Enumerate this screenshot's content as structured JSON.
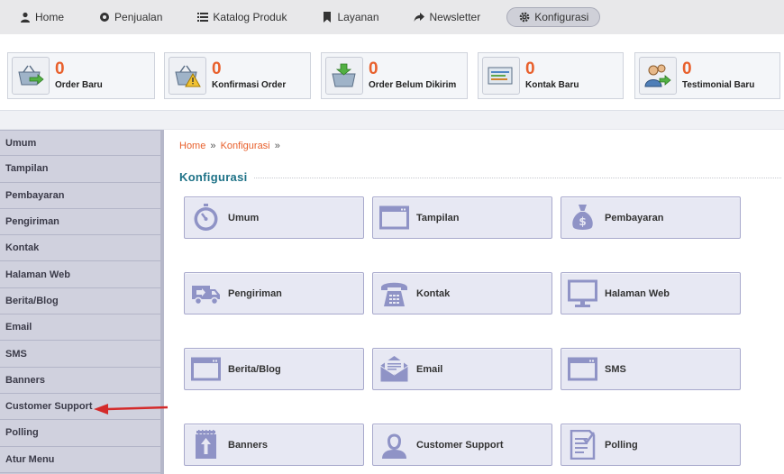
{
  "nav": {
    "items": [
      {
        "label": "Home",
        "icon": "user-icon"
      },
      {
        "label": "Penjualan",
        "icon": "record-icon"
      },
      {
        "label": "Katalog Produk",
        "icon": "list-icon"
      },
      {
        "label": "Layanan",
        "icon": "bookmark-icon"
      },
      {
        "label": "Newsletter",
        "icon": "share-icon"
      },
      {
        "label": "Konfigurasi",
        "icon": "gear-icon",
        "active": true
      }
    ]
  },
  "stats": [
    {
      "count": "0",
      "label": "Order Baru",
      "icon": "basket-arrow-icon"
    },
    {
      "count": "0",
      "label": "Konfirmasi Order",
      "icon": "basket-warning-icon"
    },
    {
      "count": "0",
      "label": "Order Belum Dikirim",
      "icon": "basket-down-icon"
    },
    {
      "count": "0",
      "label": "Kontak Baru",
      "icon": "contact-card-icon"
    },
    {
      "count": "0",
      "label": "Testimonial Baru",
      "icon": "users-arrow-icon"
    }
  ],
  "sidebar": {
    "items": [
      {
        "label": "Umum"
      },
      {
        "label": "Tampilan"
      },
      {
        "label": "Pembayaran"
      },
      {
        "label": "Pengiriman"
      },
      {
        "label": "Kontak"
      },
      {
        "label": "Halaman Web"
      },
      {
        "label": "Berita/Blog"
      },
      {
        "label": "Email"
      },
      {
        "label": "SMS"
      },
      {
        "label": "Banners"
      },
      {
        "label": "Customer Support"
      },
      {
        "label": "Polling"
      },
      {
        "label": "Atur Menu"
      }
    ]
  },
  "breadcrumb": {
    "home": "Home",
    "current": "Konfigurasi",
    "sep": "»"
  },
  "section": {
    "title": "Konfigurasi"
  },
  "tiles": [
    {
      "label": "Umum",
      "icon": "stopwatch-icon"
    },
    {
      "label": "Tampilan",
      "icon": "window-icon"
    },
    {
      "label": "Pembayaran",
      "icon": "money-bag-icon"
    },
    {
      "label": "Pengiriman",
      "icon": "delivery-truck-icon"
    },
    {
      "label": "Kontak",
      "icon": "telephone-icon"
    },
    {
      "label": "Halaman Web",
      "icon": "monitor-icon"
    },
    {
      "label": "Berita/Blog",
      "icon": "window-icon"
    },
    {
      "label": "Email",
      "icon": "envelope-icon"
    },
    {
      "label": "SMS",
      "icon": "window-icon"
    },
    {
      "label": "Banners",
      "icon": "banner-icon"
    },
    {
      "label": "Customer Support",
      "icon": "support-person-icon"
    },
    {
      "label": "Polling",
      "icon": "checklist-icon"
    }
  ],
  "colors": {
    "accent": "#e8602c",
    "title": "#1e7287",
    "tile_icon": "#8f93c6",
    "annotation_arrow": "#d42a2a"
  }
}
